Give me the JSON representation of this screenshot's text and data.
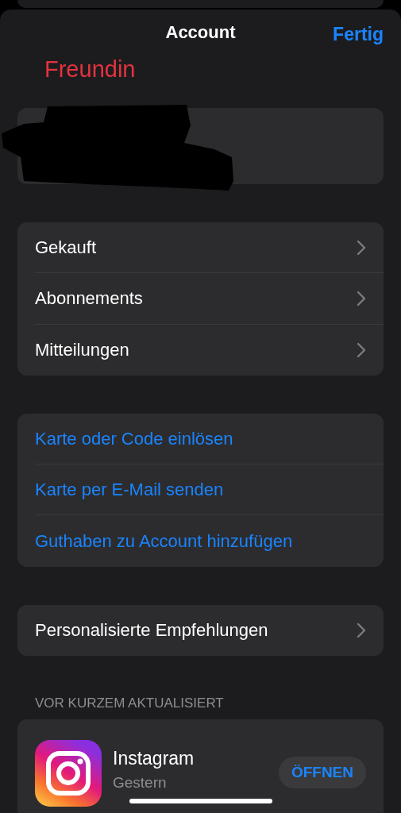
{
  "header": {
    "title": "Account",
    "done_button": "Fertig"
  },
  "annotation": {
    "text": "Freundin",
    "color": "#e5323f"
  },
  "profile": {
    "redacted": true
  },
  "groups": [
    {
      "rows": [
        {
          "label": "Gekauft",
          "kind": "link"
        },
        {
          "label": "Abonnements",
          "kind": "link"
        },
        {
          "label": "Mitteilungen",
          "kind": "link"
        }
      ]
    },
    {
      "rows": [
        {
          "label": "Karte oder Code einlösen",
          "kind": "action"
        },
        {
          "label": "Karte per E-Mail senden",
          "kind": "action"
        },
        {
          "label": "Guthaben zu Account hinzufügen",
          "kind": "action"
        }
      ]
    },
    {
      "rows": [
        {
          "label": "Personalisierte Empfehlungen",
          "kind": "link"
        }
      ]
    }
  ],
  "recent": {
    "heading": "VOR KURZEM AKTUALISIERT",
    "apps": [
      {
        "name": "Instagram",
        "date": "Gestern",
        "button": "ÖFFNEN"
      }
    ]
  }
}
